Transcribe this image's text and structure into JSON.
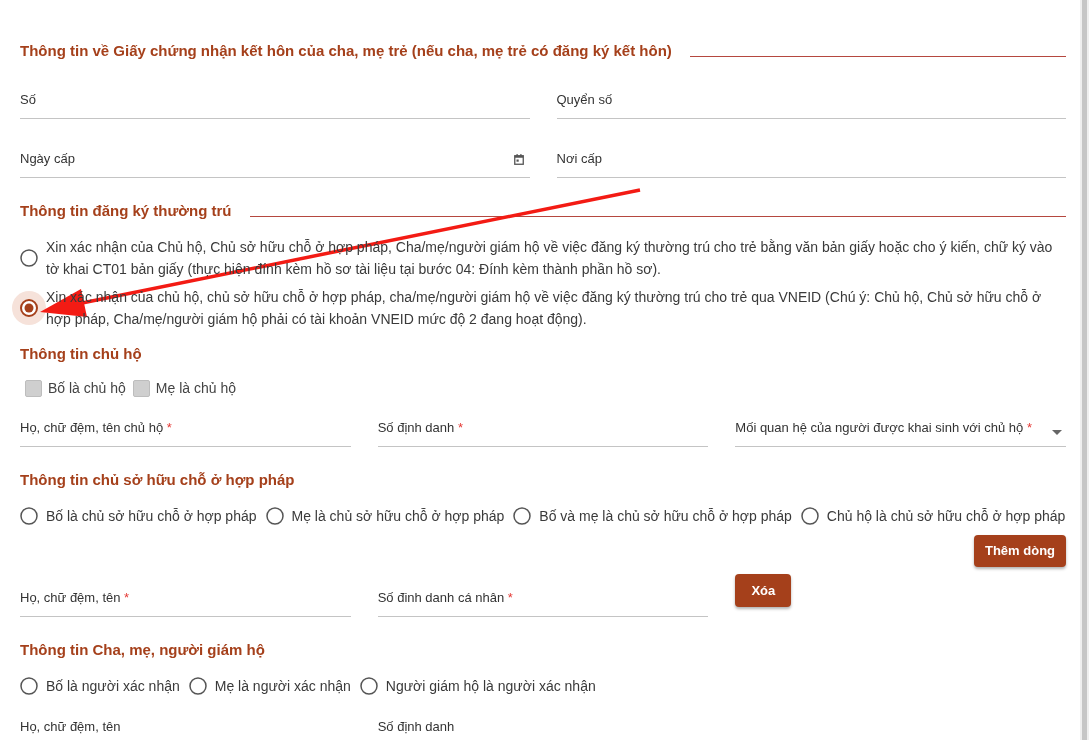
{
  "sections": [
    {
      "heading": "Thông tin về Giấy chứng nhận kết hôn của cha, mẹ trẻ (nếu cha, mẹ trẻ có đăng ký kết hôn)",
      "rule": true,
      "blocks": [
        {
          "kind": "pair",
          "fields": [
            {
              "kind": "text",
              "label": "Số"
            },
            {
              "kind": "text",
              "label": "Quyển số"
            }
          ]
        },
        {
          "kind": "pair",
          "fields": [
            {
              "kind": "date",
              "label": "Ngày cấp"
            },
            {
              "kind": "text",
              "label": "Nơi cấp"
            }
          ]
        }
      ]
    },
    {
      "heading": "Thông tin đăng ký thường trú",
      "rule": true,
      "blocks": [
        {
          "kind": "radio_stack",
          "options": [
            {
              "label": "Xin xác nhận của Chủ hộ, Chủ sở hữu chỗ ở hợp pháp, Cha/mẹ/người giám hộ về việc đăng ký thường trú cho trẻ bằng văn bản giấy hoặc cho ý kiến, chữ ký vào tờ khai CT01 bản giấy (thực hiện đính kèm hồ sơ tài liệu tại bước 04: Đính kèm thành phần hồ sơ).",
              "selected": false
            },
            {
              "label": "Xin xác nhận của chủ hộ, chủ sở hữu chỗ ở hợp pháp, cha/mẹ/người giám hộ về việc đăng ký thường trú cho trẻ qua VNEID (Chú ý: Chủ hộ, Chủ sở hữu chỗ ở hợp pháp, Cha/mẹ/người giám hộ phải có tài khoản VNEID mức độ 2 đang hoạt động).",
              "selected": true
            }
          ]
        }
      ]
    },
    {
      "heading": "Thông tin chủ hộ",
      "rule": false,
      "blocks": [
        {
          "kind": "checkboxes",
          "options": [
            {
              "label": "Bố là chủ hộ",
              "checked": false,
              "disabled": true
            },
            {
              "label": "Mẹ là chủ hộ",
              "checked": false,
              "disabled": true
            }
          ]
        },
        {
          "kind": "grid",
          "fields": [
            {
              "kind": "text",
              "label": "Họ, chữ đệm, tên chủ hộ",
              "required_mark": "*"
            },
            {
              "kind": "text",
              "label": "Số định danh",
              "required_mark": "*"
            },
            {
              "kind": "select",
              "label": "Mối quan hệ của người được khai sinh với chủ hộ",
              "required_mark": "*"
            }
          ]
        }
      ]
    },
    {
      "heading": "Thông tin chủ sở hữu chỗ ở hợp pháp",
      "rule": false,
      "blocks": [
        {
          "kind": "radio_row",
          "options": [
            {
              "label": "Bố là chủ sở hữu chỗ ở hợp pháp",
              "selected": false
            },
            {
              "label": "Mẹ là chủ sở hữu chỗ ở hợp pháp",
              "selected": false
            },
            {
              "label": "Bố và mẹ là chủ sở hữu chỗ ở hợp pháp",
              "selected": false
            },
            {
              "label": "Chủ hộ là chủ sở hữu chỗ ở hợp pháp",
              "selected": false
            }
          ]
        },
        {
          "kind": "add_button",
          "label": "Thêm dòng"
        },
        {
          "kind": "grid",
          "fields": [
            {
              "kind": "text",
              "label": "Họ, chữ đệm, tên",
              "required_mark": "*"
            },
            {
              "kind": "text",
              "label": "Số đinh danh cá nhân",
              "required_mark": "*"
            },
            {
              "kind": "delete_button",
              "label": "Xóa"
            }
          ]
        }
      ]
    },
    {
      "heading": "Thông tin Cha, mẹ, người giám hộ",
      "rule": false,
      "blocks": [
        {
          "kind": "radio_row",
          "options": [
            {
              "label": "Bố là người xác nhận",
              "selected": false
            },
            {
              "label": "Mẹ là người xác nhận",
              "selected": false
            },
            {
              "label": "Người giám hộ là người xác nhận",
              "selected": false
            }
          ]
        },
        {
          "kind": "grid",
          "fields": [
            {
              "kind": "text",
              "label": "Họ, chữ đệm, tên"
            },
            {
              "kind": "text",
              "label": "Số định danh"
            }
          ]
        }
      ]
    }
  ],
  "annotations": [
    {
      "kind": "arrow"
    }
  ]
}
